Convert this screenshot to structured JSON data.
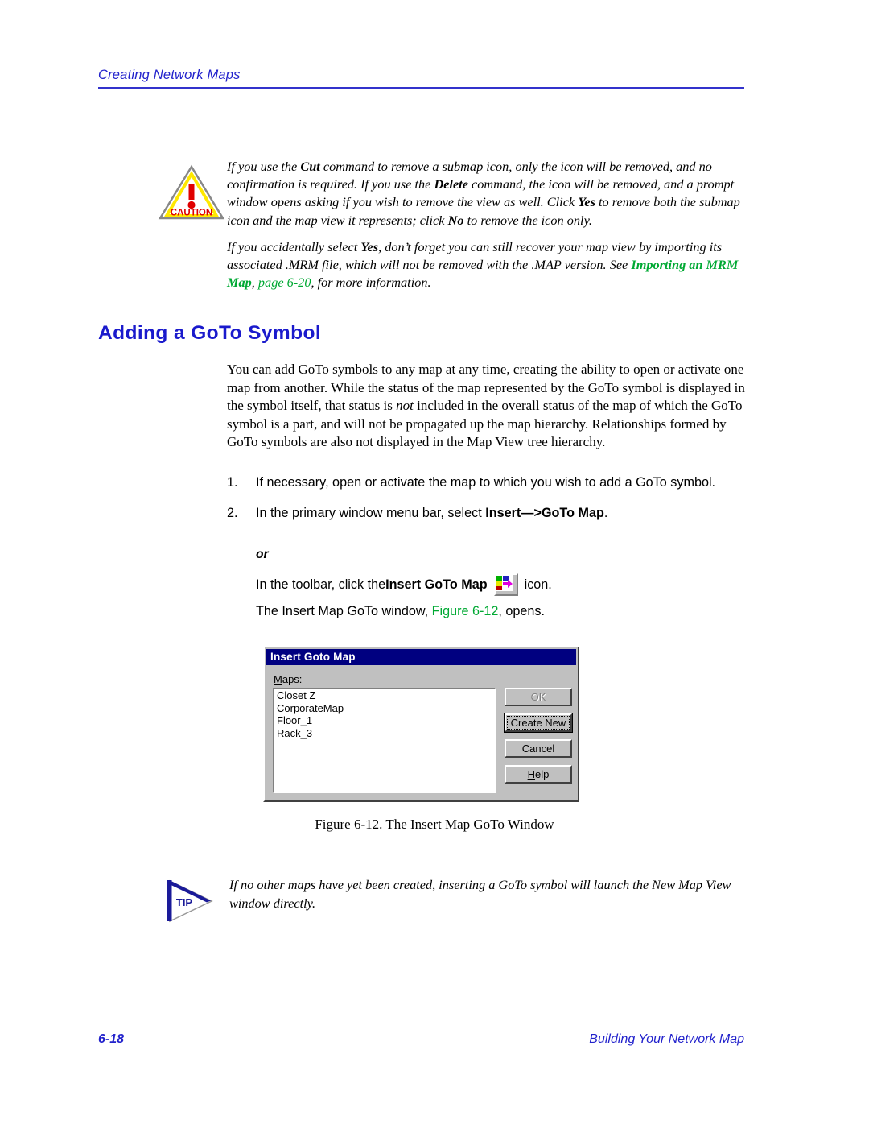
{
  "header": {
    "title": "Creating Network Maps"
  },
  "caution": {
    "icon_label": "CAUTION",
    "paragraph_parts": [
      "If you use the ",
      "Cut",
      " command to remove a submap icon, only the icon will be removed, and no confirmation is required. If you use the ",
      "Delete",
      " command, the icon will be removed, and a prompt window opens asking if you wish to remove the view as well. Click ",
      "Yes",
      " to remove both the submap icon and the map view it represents; click ",
      "No",
      " to remove the icon only."
    ],
    "text_full": "If you use the Cut command to remove a submap icon, only the icon will be removed, and no confirmation is required. If you use the Delete command, the icon will be removed, and a prompt window opens asking if you wish to remove the view as well. Click Yes to remove both the submap icon and the map view it represents; click No to remove the icon only."
  },
  "note2": {
    "lead": "If you accidentally select ",
    "bold_yes": "Yes",
    "middle": ", don’t forget you can still recover your map view by importing its associated .MRM file, which will not be removed with the .MAP version. See ",
    "xref_title": "Importing an MRM Map",
    "xref_comma": ", ",
    "xref_page": "page 6-20",
    "tail": ", for more information."
  },
  "section": {
    "heading": "Adding a GoTo Symbol"
  },
  "body": {
    "para_lead": "You can add GoTo symbols to any map at any time, creating the ability to open or activate one map from another. While the status of the map represented by the GoTo symbol is displayed in the symbol itself, that status is ",
    "para_italic": "not",
    "para_tail": " included in the overall status of the map of which the GoTo symbol is a part, and will not be propagated up the map hierarchy. Relationships formed by GoTo symbols are also not displayed in the Map View tree hierarchy."
  },
  "steps": [
    {
      "num": "1.",
      "text": "If necessary, open or activate the map to which you wish to add a GoTo symbol."
    },
    {
      "num": "2.",
      "lead": "In the primary window menu bar, select ",
      "bold": "Insert—>GoTo Map",
      "tail": "."
    }
  ],
  "or_label": "or",
  "toolbar_instruction": {
    "lead": "In the toolbar, click the ",
    "bold": "Insert GoTo Map",
    "icon_name": "insert-goto-map-icon",
    "tail": "icon."
  },
  "figure_line": {
    "lead": "The Insert Map GoTo window, ",
    "xref": "Figure 6-12",
    "tail": ", opens."
  },
  "dialog": {
    "title": "Insert Goto Map",
    "list_label_underlined": "M",
    "list_label_rest": "aps:",
    "items": [
      "Closet Z",
      "CorporateMap",
      "Floor_1",
      "Rack_3"
    ],
    "buttons": [
      {
        "label": "OK",
        "state": "disabled"
      },
      {
        "label": "Create New",
        "state": "focused"
      },
      {
        "label": "Cancel",
        "state": "normal"
      },
      {
        "label": "Help",
        "state": "normal",
        "mnemonic": "H"
      }
    ]
  },
  "figure_caption": "Figure 6-12.  The Insert Map GoTo Window",
  "tip": {
    "icon_label": "TIP",
    "text": "If no other maps have yet been created, inserting a GoTo symbol will launch the New Map View window directly."
  },
  "footer": {
    "page_number": "6-18",
    "book_title": "Building Your Network Map"
  },
  "colors": {
    "header_blue": "#2222cc",
    "heading_blue": "#1a1acc",
    "xref_green": "#00a933",
    "dialog_titlebar": "#000080",
    "dialog_face": "#c0c0c0"
  }
}
